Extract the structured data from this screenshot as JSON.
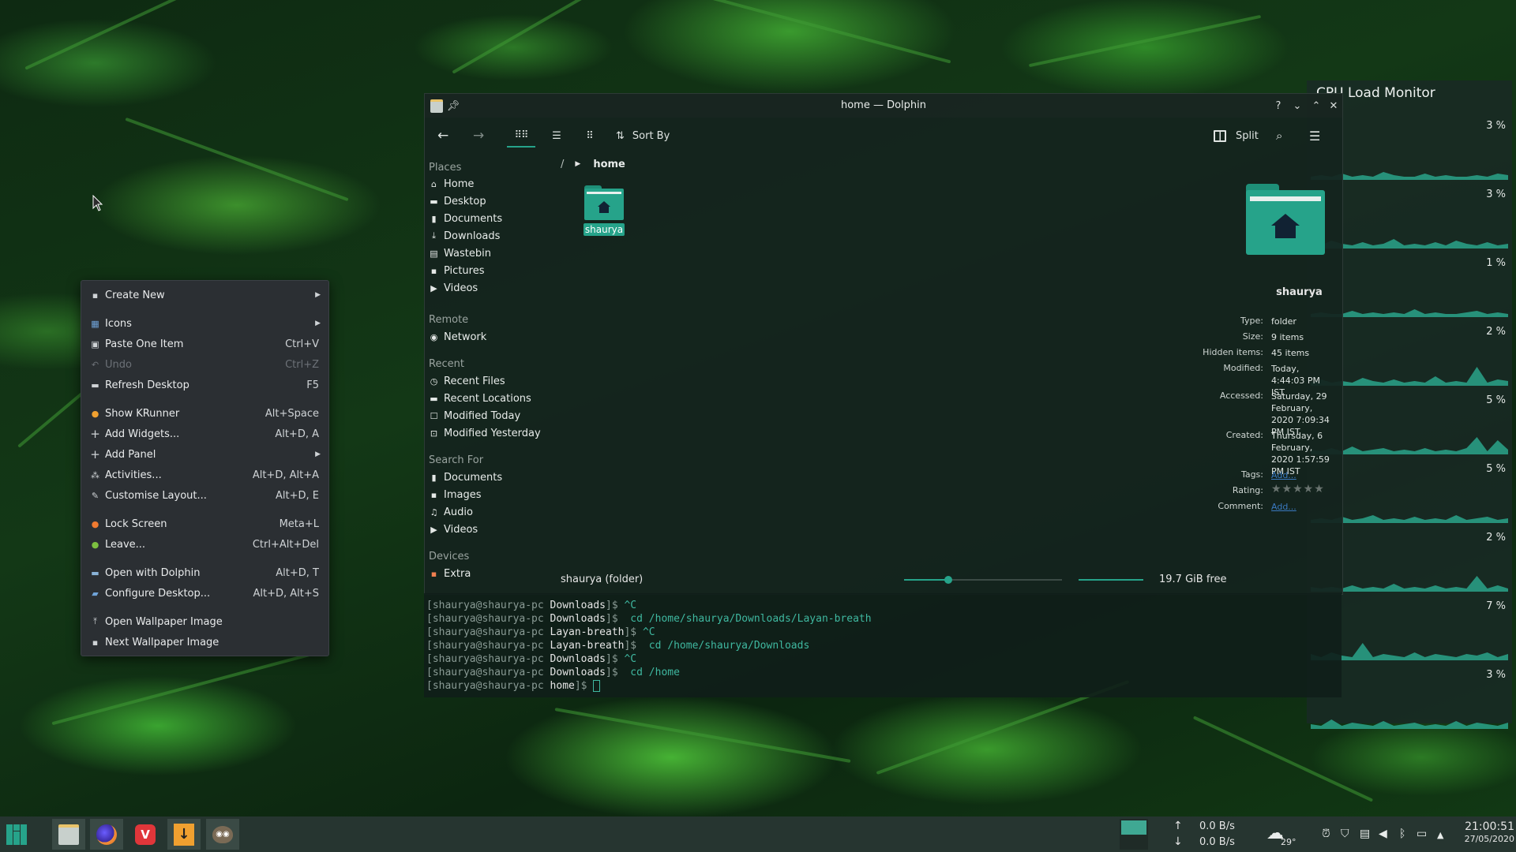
{
  "context_menu": {
    "items": [
      {
        "label": "Create New",
        "shortcut": "",
        "submenu": true,
        "icon": "new-file-icon"
      },
      {
        "label": "Icons",
        "shortcut": "",
        "submenu": true,
        "icon": "icons-icon"
      },
      {
        "label": "Paste One Item",
        "shortcut": "Ctrl+V",
        "icon": "paste-icon"
      },
      {
        "label": "Undo",
        "shortcut": "Ctrl+Z",
        "disabled": true,
        "icon": "undo-icon"
      },
      {
        "label": "Refresh Desktop",
        "shortcut": "F5",
        "icon": "refresh-icon"
      },
      {
        "label": "Show KRunner",
        "shortcut": "Alt+Space",
        "icon": "krunner-icon"
      },
      {
        "label": "Add Widgets...",
        "shortcut": "Alt+D, A",
        "icon": "plus-icon"
      },
      {
        "label": "Add Panel",
        "shortcut": "",
        "submenu": true,
        "icon": "plus-icon"
      },
      {
        "label": "Activities...",
        "shortcut": "Alt+D, Alt+A",
        "icon": "activities-icon"
      },
      {
        "label": "Customise Layout...",
        "shortcut": "Alt+D, E",
        "icon": "pencil-icon"
      },
      {
        "label": "Lock Screen",
        "shortcut": "Meta+L",
        "icon": "lock-icon"
      },
      {
        "label": "Leave...",
        "shortcut": "Ctrl+Alt+Del",
        "icon": "leave-icon"
      },
      {
        "label": "Open with Dolphin",
        "shortcut": "Alt+D, T",
        "icon": "dolphin-icon"
      },
      {
        "label": "Configure Desktop...",
        "shortcut": "Alt+D, Alt+S",
        "icon": "configure-icon"
      },
      {
        "label": "Open Wallpaper Image",
        "shortcut": "",
        "icon": "upload-icon"
      },
      {
        "label": "Next Wallpaper Image",
        "shortcut": "",
        "icon": "image-icon"
      }
    ]
  },
  "dolphin": {
    "title": "home — Dolphin",
    "toolbar": {
      "sort_label": "Sort By",
      "split_label": "Split"
    },
    "places": {
      "places_header": "Places",
      "places": [
        "Home",
        "Desktop",
        "Documents",
        "Downloads",
        "Wastebin",
        "Pictures",
        "Videos"
      ],
      "remote_header": "Remote",
      "remote": [
        "Network"
      ],
      "recent_header": "Recent",
      "recent": [
        "Recent Files",
        "Recent Locations",
        "Modified Today",
        "Modified Yesterday"
      ],
      "search_header": "Search For",
      "search": [
        "Documents",
        "Images",
        "Audio",
        "Videos"
      ],
      "devices_header": "Devices",
      "devices": [
        "Extra"
      ]
    },
    "breadcrumb": {
      "root": "/",
      "current": "home"
    },
    "file": {
      "name": "shaurya"
    },
    "info": {
      "name": "shaurya",
      "type_label": "Type:",
      "type": "folder",
      "size_label": "Size:",
      "size": "9 items",
      "hidden_label": "Hidden items:",
      "hidden": "45 items",
      "modified_label": "Modified:",
      "modified": "Today, 4:44:03 PM IST",
      "accessed_label": "Accessed:",
      "accessed": "Saturday, 29 February, 2020 7:09:34 PM IST",
      "created_label": "Created:",
      "created": "Thursday, 6 February, 2020 1:57:59 PM IST",
      "tags_label": "Tags:",
      "tags": "Add...",
      "rating_label": "Rating:",
      "rating": 0,
      "comment_label": "Comment:",
      "comment": "Add..."
    },
    "status": {
      "selection": "shaurya (folder)",
      "free": "19.7 GiB free"
    }
  },
  "terminal": {
    "lines": [
      {
        "user": "[shaurya@shaurya-pc",
        "dir": "Downloads",
        "cmd": "^C"
      },
      {
        "user": "[shaurya@shaurya-pc",
        "dir": "Downloads",
        "cmd": " cd /home/shaurya/Downloads/Layan-breath"
      },
      {
        "user": "[shaurya@shaurya-pc",
        "dir": "Layan-breath",
        "cmd": "^C"
      },
      {
        "user": "[shaurya@shaurya-pc",
        "dir": "Layan-breath",
        "cmd": " cd /home/shaurya/Downloads"
      },
      {
        "user": "[shaurya@shaurya-pc",
        "dir": "Downloads",
        "cmd": "^C"
      },
      {
        "user": "[shaurya@shaurya-pc",
        "dir": "Downloads",
        "cmd": " cd /home"
      },
      {
        "user": "[shaurya@shaurya-pc",
        "dir": "home",
        "cmd": ""
      }
    ]
  },
  "cpu_monitor": {
    "title": "CPU Load Monitor",
    "cores": [
      "3 %",
      "3 %",
      "1 %",
      "2 %",
      "5 %",
      "5 %",
      "2 %",
      "7 %",
      "3 %"
    ]
  },
  "taskbar": {
    "net_up": "0.0 B/s",
    "net_down": "0.0 B/s",
    "weather": "29°",
    "time": "21:00:51",
    "date": "27/05/2020"
  },
  "colors": {
    "accent": "#26a38a",
    "menu_bg": "#2b2f33",
    "window_bg": "#14241e",
    "panel": "#263530"
  }
}
